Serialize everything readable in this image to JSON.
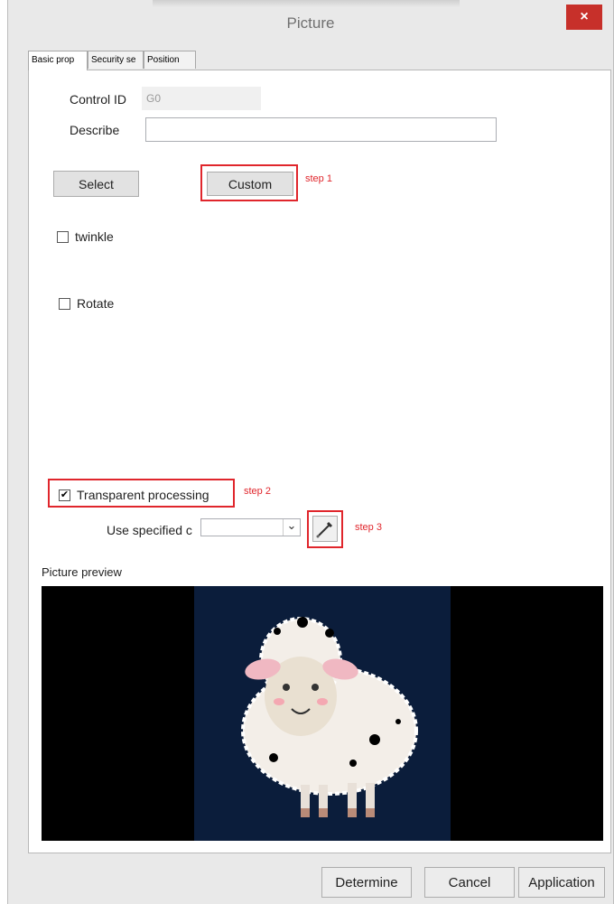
{
  "window": {
    "title": "Picture",
    "close_glyph": "×"
  },
  "tabs": [
    {
      "label": "Basic prop"
    },
    {
      "label": "Security se"
    },
    {
      "label": "Position"
    }
  ],
  "basic": {
    "control_id_label": "Control ID",
    "control_id_value": "G0",
    "describe_label": "Describe",
    "describe_value": "",
    "select_label": "Select",
    "custom_label": "Custom",
    "twinkle_label": "twinkle",
    "rotate_label": "Rotate",
    "transparent_label": "Transparent processing",
    "transparent_checked": true,
    "use_specified_label": "Use specified c",
    "color_value": "",
    "preview_label": "Picture preview"
  },
  "annotations": {
    "step1": "step 1",
    "step2": "step 2",
    "step3": "step 3"
  },
  "buttons": {
    "determine": "Determine",
    "cancel": "Cancel",
    "application": "Application"
  },
  "icons": {
    "check": "✔",
    "chevron": "⌄",
    "eyedropper": "eyedropper-icon"
  },
  "colors": {
    "annotation_red": "#e0262c",
    "close_red": "#c7302a",
    "preview_bg": "#000000",
    "image_bg": "#0b1d3b"
  }
}
